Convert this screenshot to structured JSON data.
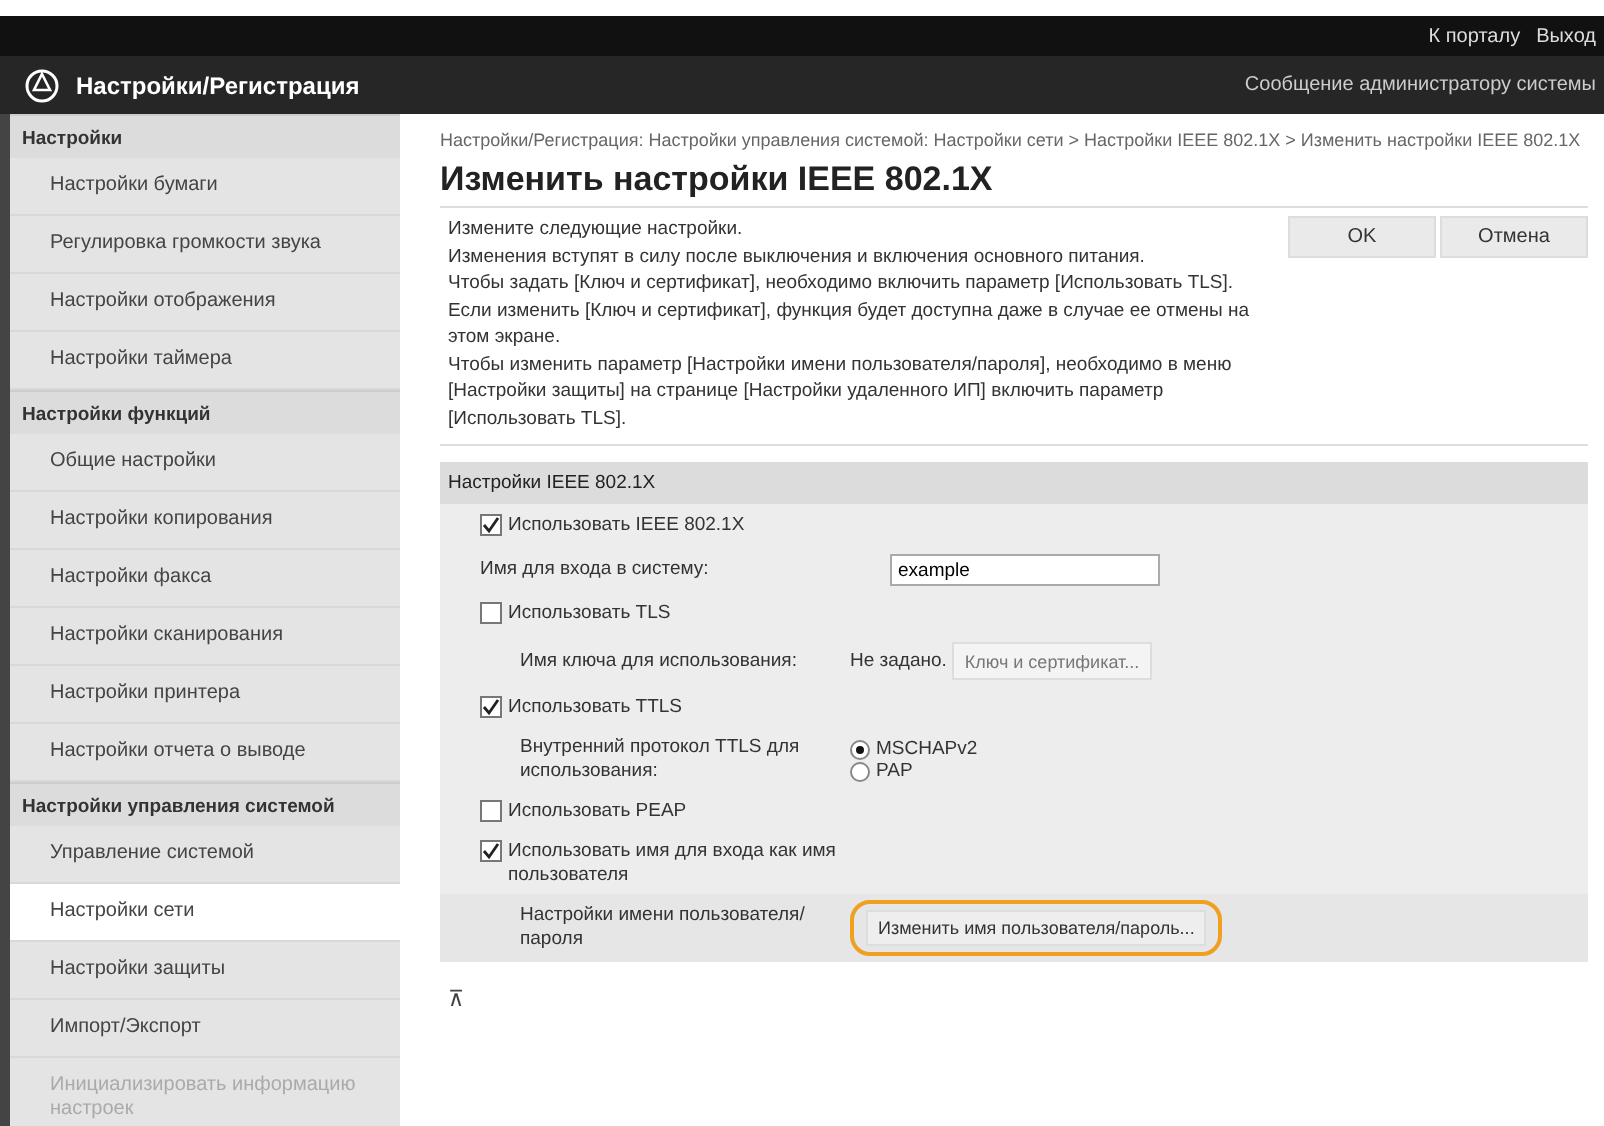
{
  "top_bar": {
    "links": [
      "К порталу",
      "Выход"
    ]
  },
  "header": {
    "title": "Настройки/Регистрация",
    "admin_message": "Сообщение администратору системы"
  },
  "sidebar": {
    "sections": [
      {
        "title": "Настройки",
        "items": [
          {
            "label": "Настройки бумаги",
            "selected": false,
            "disabled": false
          },
          {
            "label": "Регулировка громкости звука",
            "selected": false,
            "disabled": false
          },
          {
            "label": "Настройки отображения",
            "selected": false,
            "disabled": false
          },
          {
            "label": "Настройки таймера",
            "selected": false,
            "disabled": false
          }
        ]
      },
      {
        "title": "Настройки функций",
        "items": [
          {
            "label": "Общие настройки",
            "selected": false,
            "disabled": false
          },
          {
            "label": "Настройки копирования",
            "selected": false,
            "disabled": false
          },
          {
            "label": "Настройки факса",
            "selected": false,
            "disabled": false
          },
          {
            "label": "Настройки сканирования",
            "selected": false,
            "disabled": false
          },
          {
            "label": "Настройки принтера",
            "selected": false,
            "disabled": false
          },
          {
            "label": "Настройки отчета о выводе",
            "selected": false,
            "disabled": false
          }
        ]
      },
      {
        "title": "Настройки управления системой",
        "items": [
          {
            "label": "Управление системой",
            "selected": false,
            "disabled": false
          },
          {
            "label": "Настройки сети",
            "selected": true,
            "disabled": false
          },
          {
            "label": "Настройки защиты",
            "selected": false,
            "disabled": false
          },
          {
            "label": "Импорт/Экспорт",
            "selected": false,
            "disabled": false
          },
          {
            "label": "Инициализировать информацию настроек",
            "selected": false,
            "disabled": true
          }
        ]
      }
    ]
  },
  "breadcrumb": "Настройки/Регистрация: Настройки управления системой: Настройки сети > Настройки IEEE 802.1X > Изменить настройки IEEE 802.1X",
  "page_title": "Изменить настройки IEEE 802.1X",
  "instructions": [
    "Измените следующие настройки.",
    "Изменения вступят в силу после выключения и включения основного питания.",
    "Чтобы задать [Ключ и сертификат], необходимо включить параметр [Использовать TLS].",
    "Если изменить [Ключ и сертификат], функция будет доступна даже в случае ее отмены на этом экране.",
    "Чтобы изменить параметр [Настройки имени пользователя/пароля], необходимо в меню [Настройки защиты] на странице [Настройки удаленного ИП] включить параметр [Использовать TLS]."
  ],
  "buttons": [
    "OK",
    "Отмена"
  ],
  "section": {
    "title": "Настройки IEEE 802.1X",
    "rows": [
      {
        "kind": "checkbox",
        "label": "Использовать IEEE 802.1X",
        "checked": true
      },
      {
        "kind": "field",
        "label": "Имя для входа в систему:",
        "value": "example"
      },
      {
        "kind": "checkbox",
        "label": "Использовать TLS",
        "checked": false
      },
      {
        "kind": "key",
        "label": "Имя ключа для использования:",
        "value": "Не задано.",
        "button": "Ключ и сертификат..."
      },
      {
        "kind": "checkbox",
        "label": "Использовать TTLS",
        "checked": true
      },
      {
        "kind": "radio",
        "label": "Внутренний протокол TTLS для использования:",
        "options": [
          {
            "label": "MSCHAPv2",
            "selected": true
          },
          {
            "label": "PAP",
            "selected": false
          }
        ]
      },
      {
        "kind": "checkbox",
        "label": "Использовать PEAP",
        "checked": false
      },
      {
        "kind": "checkbox",
        "label": "Использовать имя для входа как имя пользователя",
        "checked": true
      },
      {
        "kind": "button",
        "label": "Настройки имени пользователя/пароля",
        "button": "Изменить имя пользователя/пароль...",
        "highlighted": true
      }
    ]
  },
  "back_to_top": "⊼"
}
